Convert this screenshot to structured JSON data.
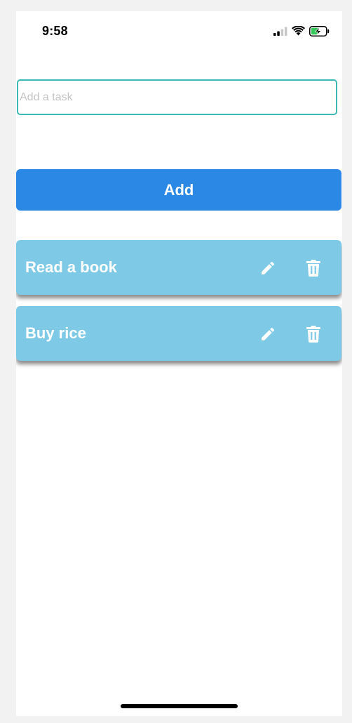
{
  "status_bar": {
    "time": "9:58",
    "icons": [
      "cellular-signal-icon",
      "wifi-icon",
      "battery-charging-icon"
    ]
  },
  "task_input": {
    "placeholder": "Add a task",
    "value": ""
  },
  "add_button": {
    "label": "Add"
  },
  "tasks": [
    {
      "label": "Read a book",
      "actions": [
        "pencil-icon",
        "trash-icon"
      ]
    },
    {
      "label": "Buy rice",
      "actions": [
        "pencil-icon",
        "trash-icon"
      ]
    }
  ],
  "colors": {
    "accent": "#2b88e5",
    "input_border": "#3cb9b5",
    "task_bg": "#7ecae6",
    "battery_fill": "#34c759"
  }
}
